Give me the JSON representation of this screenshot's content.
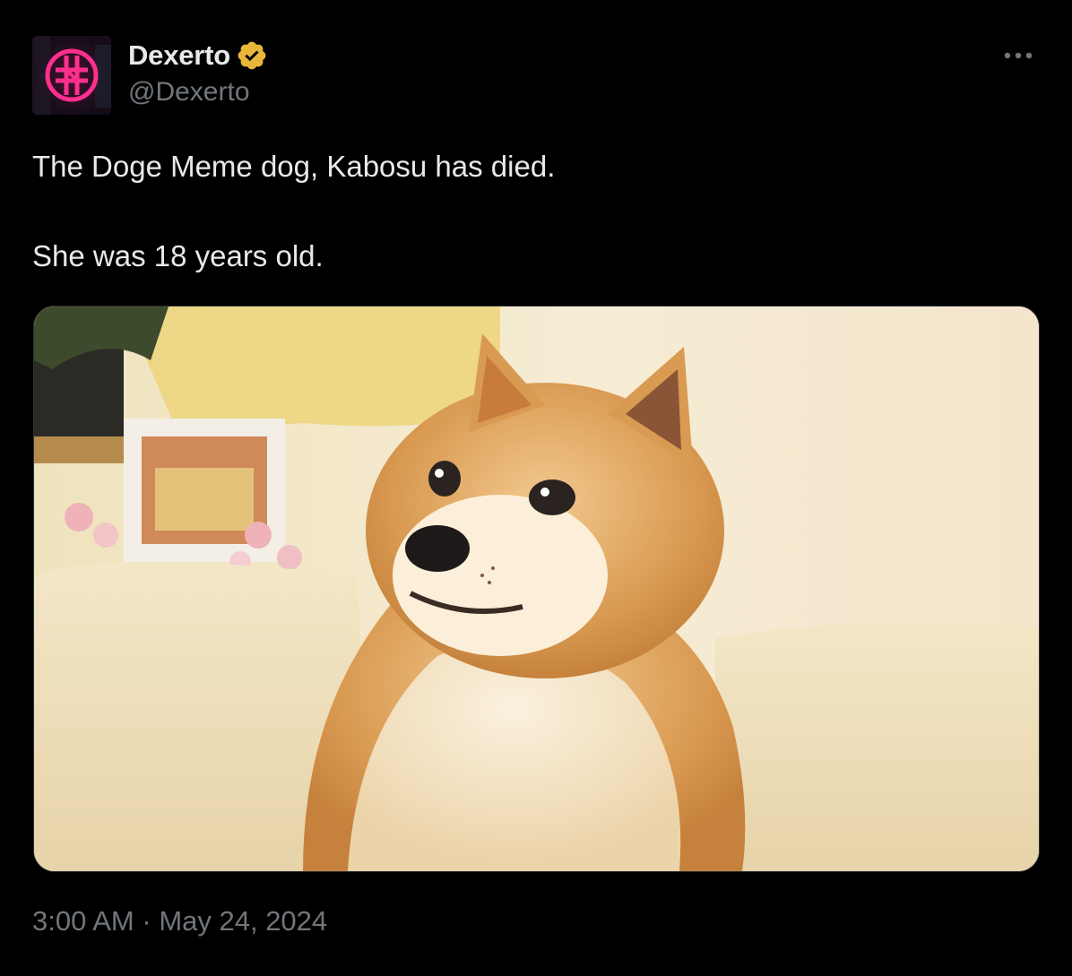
{
  "author": {
    "display_name": "Dexerto",
    "handle": "@Dexerto",
    "verified_badge_icon": "verified-badge-icon",
    "verified_color": "#e8b73a"
  },
  "menu": {
    "more_icon": "more-horizontal-icon"
  },
  "post": {
    "lines": [
      "The Doge Meme dog, Kabosu has died.",
      "She was 18 years old."
    ],
    "media_description_icon": "shiba-inu-photo"
  },
  "meta": {
    "time": "3:00 AM",
    "separator": " · ",
    "date": "May 24, 2024"
  },
  "colors": {
    "background": "#000000",
    "primary_text": "#e7e9ea",
    "secondary_text": "#71767b",
    "avatar_logo": "#ff2f8e"
  }
}
